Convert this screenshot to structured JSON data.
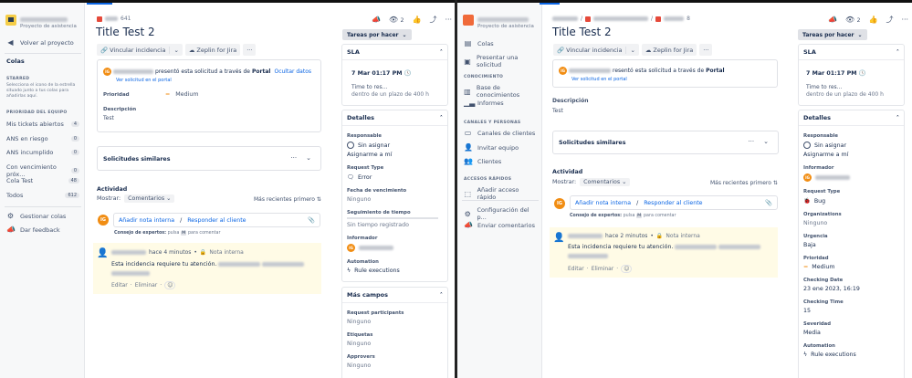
{
  "left": {
    "sidebar": {
      "project_subtitle": "Proyecto de asistencia",
      "back": "Volver al proyecto",
      "queues_heading": "Colas",
      "starred_heading": "STARRED",
      "starred_hint": "Selecciona el icono de la estrella situado junto a tus colas para añadirlas aquí.",
      "team_heading": "PRIORIDAD DEL EQUIPO",
      "queues": [
        {
          "label": "Mis tickets abiertos",
          "count": "4"
        },
        {
          "label": "ANS en riesgo",
          "count": "0"
        },
        {
          "label": "ANS incumplido",
          "count": "0"
        },
        {
          "label": "Con vencimiento próx...",
          "count": "0"
        },
        {
          "label": "Cola Test",
          "count": "48"
        },
        {
          "label": "Todos",
          "count": "612"
        }
      ],
      "manage": "Gestionar colas",
      "feedback": "Dar feedback"
    },
    "issue": {
      "key_suffix": "641",
      "title": "Title Test 2",
      "link_issue": "Vincular incidencia",
      "zeplin": "Zeplin for Jira",
      "submitted_text": "presentó esta solicitud a través de",
      "channel": "Portal",
      "hide_details": "Ocultar datos",
      "view_portal": "Ver solicitud en el portal",
      "priority_label": "Prioridad",
      "priority_value": "Medium",
      "description_label": "Descripción",
      "description_value": "Test",
      "similar": "Solicitudes similares",
      "activity": "Actividad",
      "show_label": "Mostrar:",
      "show_value": "Comentarios",
      "sort": "Más recientes primero",
      "avatar_initials": "IG",
      "add_internal": "Añadir nota interna",
      "sep": "/",
      "reply": "Responder al cliente",
      "tip_bold": "Consejo de expertos:",
      "tip_pre": "pulsa",
      "tip_key": "M",
      "tip_post": "para comentar",
      "comment_time": "hace 4 minutos",
      "comment_type": "Nota interna",
      "comment_text": "Esta incidencia requiere tu atención.",
      "edit": "Editar",
      "delete": "Eliminar",
      "watchers": "2"
    },
    "panel": {
      "status": "Tareas por hacer",
      "sla_title": "SLA",
      "sla_time": "7 Mar 01:17 PM",
      "sla_name": "Time to res...",
      "sla_detail": "dentro de un plazo de 400 h",
      "details_title": "Detalles",
      "assignee_label": "Responsable",
      "assignee_value": "Sin asignar",
      "assign_me": "Asignarme a mí",
      "request_type_label": "Request Type",
      "request_type_value": "Error",
      "due_label": "Fecha de vencimiento",
      "due_value": "Ninguno",
      "time_label": "Seguimiento de tiempo",
      "time_value": "Sin tiempo registrado",
      "reporter_label": "Informador",
      "automation_label": "Automation",
      "automation_value": "Rule executions",
      "more_title": "Más campos",
      "participants_label": "Request participants",
      "participants_value": "Ninguno",
      "labels_label": "Etiquetas",
      "labels_value": "Ninguno",
      "approvers_label": "Approvers",
      "approvers_value": "Ninguno"
    }
  },
  "right": {
    "sidebar": {
      "project_subtitle": "Proyecto de asistencia",
      "items_top": [
        "Colas",
        "Presentar una solicitud"
      ],
      "knowledge_heading": "CONOCIMIENTO",
      "knowledge": [
        "Base de conocimientos",
        "Informes"
      ],
      "channels_heading": "CANALES Y PERSONAS",
      "channels": [
        "Canales de clientes",
        "Invitar equipo",
        "Clientes"
      ],
      "shortcuts_heading": "ACCESOS RÁPIDOS",
      "add_shortcut": "Añadir acceso rápido",
      "settings": "Configuración del p...",
      "feedback": "Enviar comentarios"
    },
    "issue": {
      "key_suffix": "8",
      "title": "Title Test 2",
      "link_issue": "Vincular incidencia",
      "zeplin": "Zeplin for Jira",
      "submitted_text": "resentó esta solicitud a través de",
      "channel": "Portal",
      "view_portal": "Ver solicitud en el portal",
      "description_label": "Descripción",
      "description_value": "Test",
      "similar": "Solicitudes similares",
      "activity": "Actividad",
      "show_label": "Mostrar:",
      "show_value": "Comentarios",
      "sort": "Más recientes primero",
      "avatar_initials": "IG",
      "add_internal": "Añadir nota interna",
      "sep": "/",
      "reply": "Responder al cliente",
      "tip_bold": "Consejo de expertos:",
      "tip_pre": "pulsa",
      "tip_key": "M",
      "tip_post": "para comentar",
      "comment_time": "hace 2 minutos",
      "comment_type": "Nota interna",
      "comment_text": "Esta incidencia requiere tu atención.",
      "edit": "Editar",
      "delete": "Eliminar",
      "watchers": "2"
    },
    "panel": {
      "status": "Tareas por hacer",
      "sla_title": "SLA",
      "sla_time": "7 Mar 01:17 PM",
      "sla_name": "Time to res...",
      "sla_detail": "dentro de un plazo de 400 h",
      "details_title": "Detalles",
      "assignee_label": "Responsable",
      "assignee_value": "Sin asignar",
      "assign_me": "Asignarme a mí",
      "reporter_label": "Informador",
      "request_type_label": "Request Type",
      "request_type_value": "Bug",
      "org_label": "Organizations",
      "org_value": "Ninguno",
      "urgency_label": "Urgencia",
      "urgency_value": "Baja",
      "priority_label": "Prioridad",
      "priority_value": "Medium",
      "checking_date_label": "Checking Date",
      "checking_date_value": "23 ene 2023, 16:19",
      "checking_time_label": "Checking Time",
      "checking_time_value": "15",
      "severity_label": "Severidad",
      "severity_value": "Media",
      "automation_label": "Automation",
      "automation_value": "Rule executions"
    }
  },
  "colors": {
    "accent": "#0c66e4",
    "avatar": "#f18d13",
    "note_bg": "#fffbe6",
    "sidebar_bg": "#f7f8f9"
  }
}
